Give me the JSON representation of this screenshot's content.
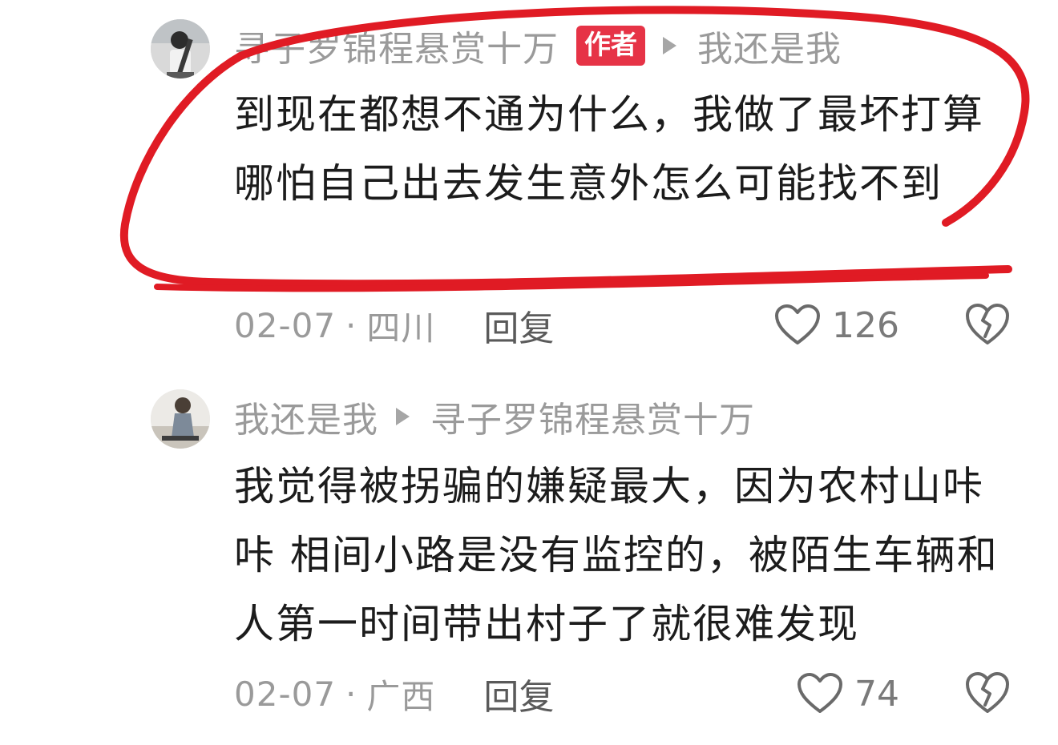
{
  "comments": [
    {
      "username": "寻子罗锦程悬赏十万",
      "badge": "作者",
      "reply_to": "我还是我",
      "text": "到现在都想不通为什么，我做了最坏打算哪怕自己出去发生意外怎么可能找不到",
      "date": "02-07",
      "dot": "·",
      "location": "四川",
      "reply_label": "回复",
      "likes": "126"
    },
    {
      "username": "我还是我",
      "reply_to": "寻子罗锦程悬赏十万",
      "text": "我觉得被拐骗的嫌疑最大，因为农村山咔咔 相间小路是没有监控的，被陌生车辆和人第一时间带出村子了就很难发现",
      "date": "02-07",
      "dot": "·",
      "location": "广西",
      "reply_label": "回复",
      "likes": "74"
    }
  ],
  "icons": {
    "like": "heart-outline-icon",
    "dislike": "broken-heart-icon",
    "reply_arrow": "triangle-right-icon"
  },
  "colors": {
    "badge": "#e63346",
    "annotation": "#e01b24",
    "meta_text": "#9a9a9a",
    "body_text": "#1c1c1c"
  }
}
